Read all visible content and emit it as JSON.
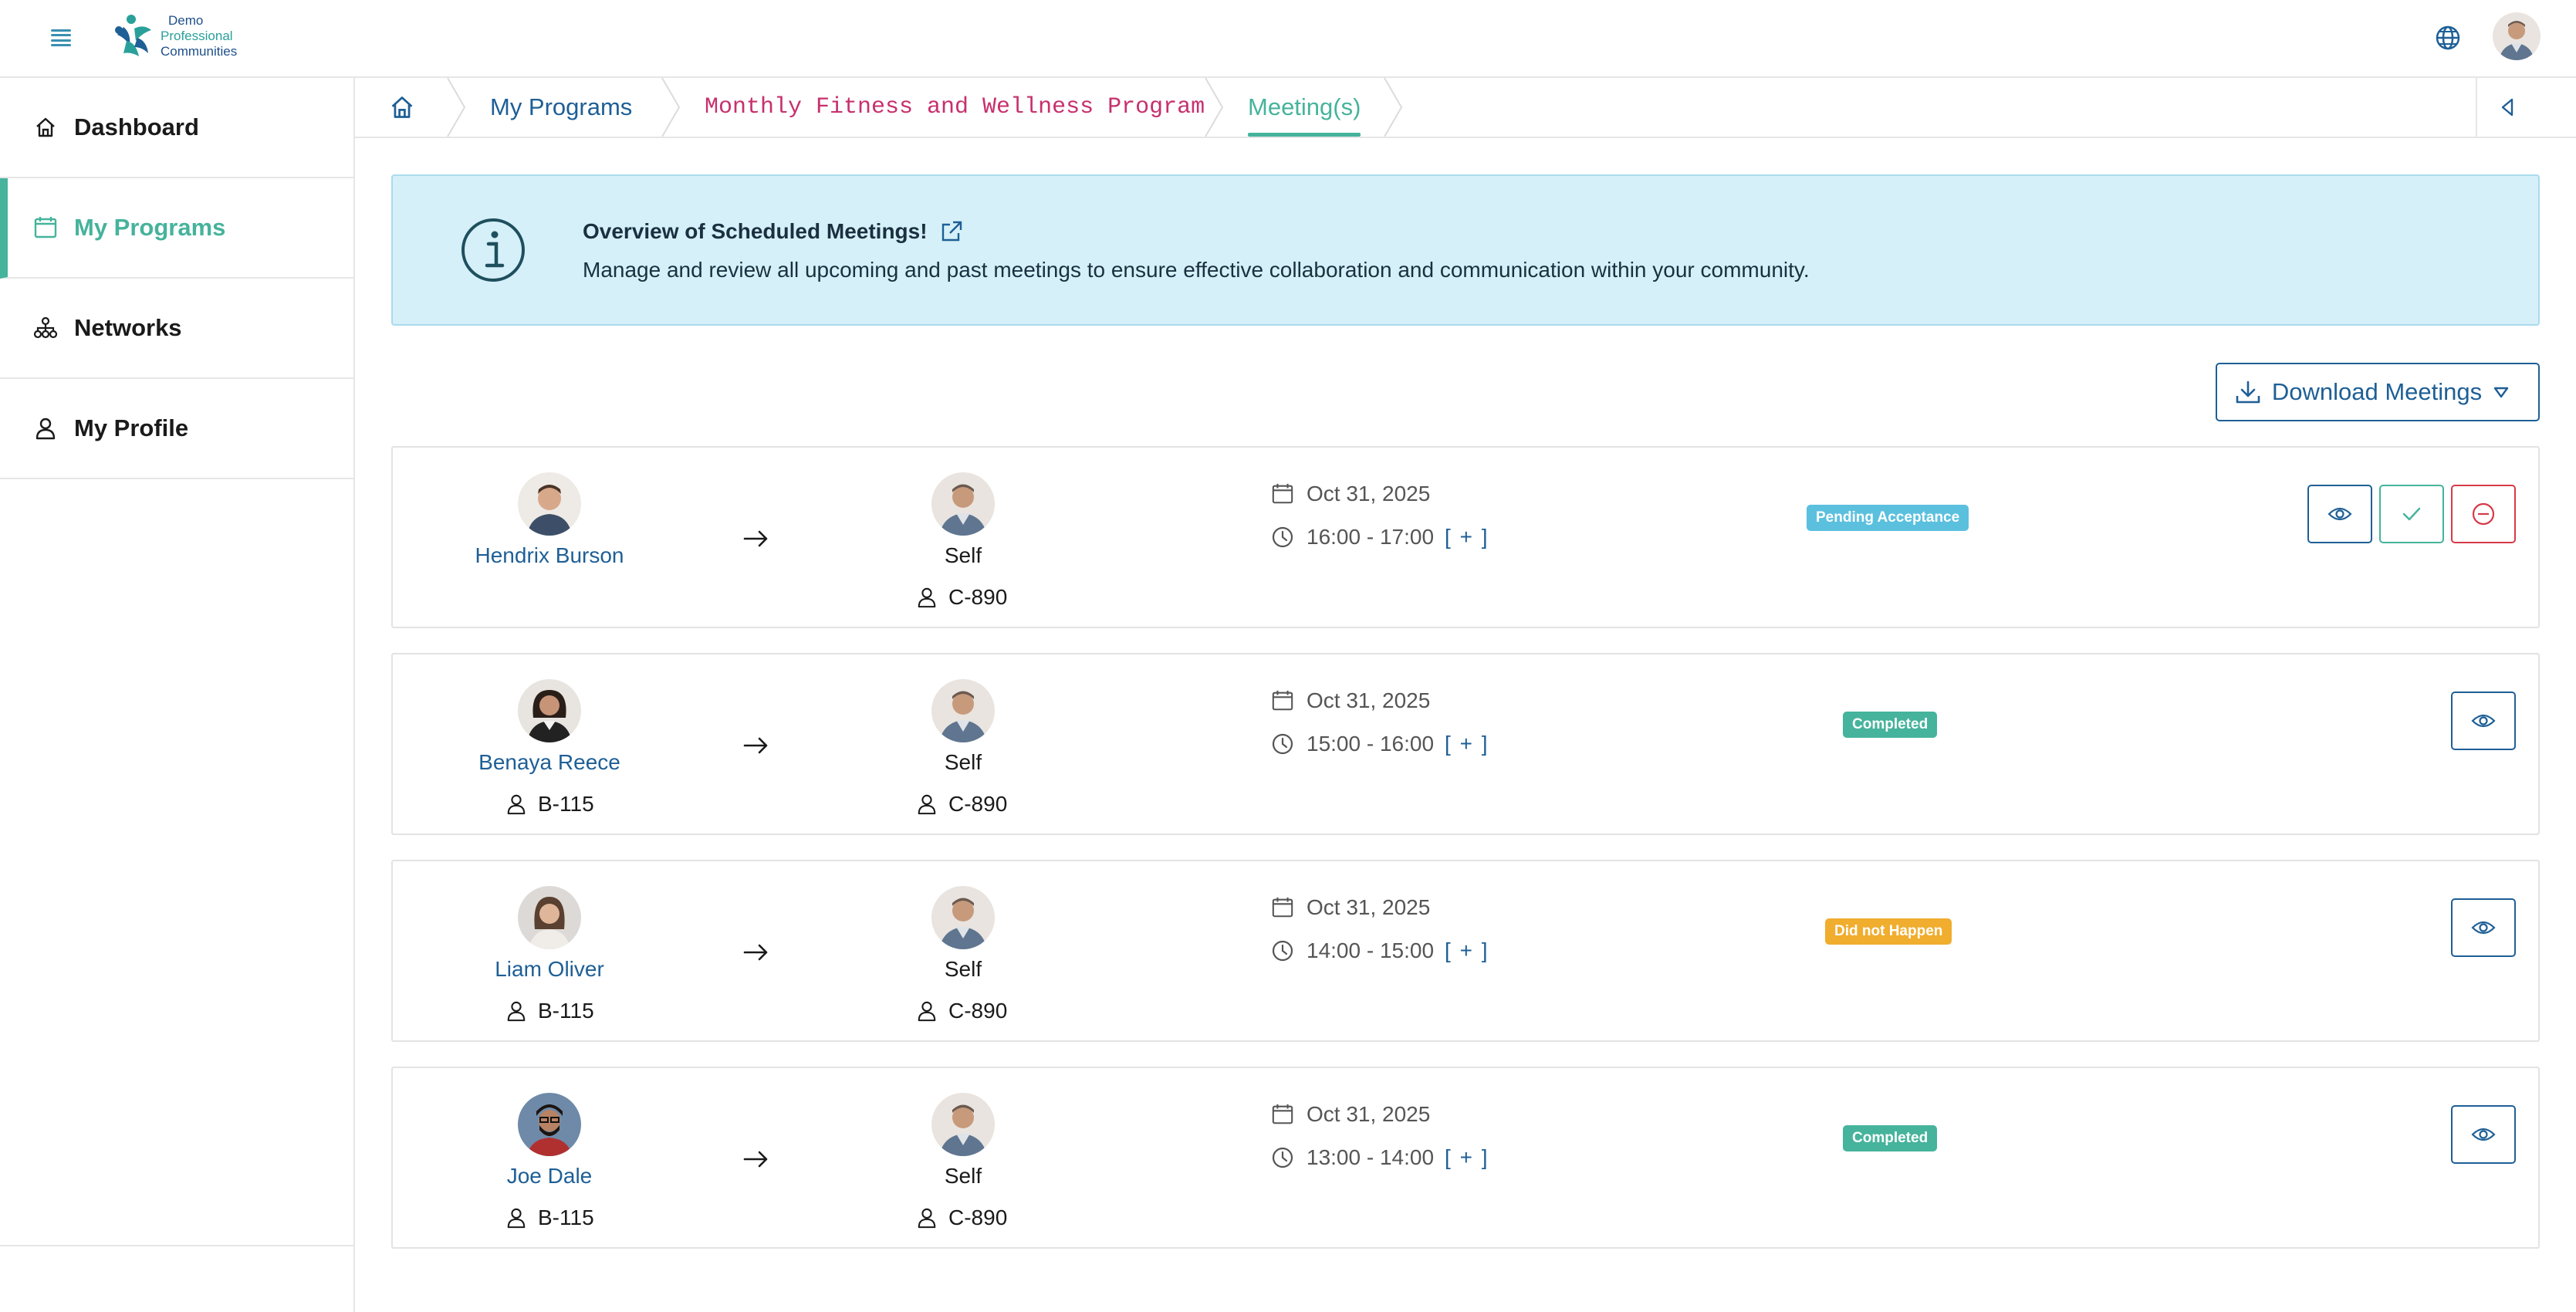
{
  "logo": {
    "line1": "Demo",
    "line2": "Professional",
    "line3": "Communities"
  },
  "sidebar": {
    "items": [
      {
        "label": "Dashboard",
        "icon": "home-icon",
        "active": false
      },
      {
        "label": "My Programs",
        "icon": "calendar-icon",
        "active": true
      },
      {
        "label": "Networks",
        "icon": "network-icon",
        "active": false
      },
      {
        "label": "My Profile",
        "icon": "user-icon",
        "active": false
      }
    ]
  },
  "breadcrumb": {
    "home_icon": "home-icon",
    "items": [
      "My Programs",
      "Monthly Fitness and Wellness Program",
      "Meeting(s)"
    ]
  },
  "info": {
    "title": "Overview of Scheduled Meetings!",
    "description": "Manage and review all upcoming and past meetings to ensure effective collaboration and communication within your community."
  },
  "download": {
    "label": "Download Meetings"
  },
  "colors": {
    "accent": "#46b39c",
    "link": "#1e5f96",
    "pending": "#5bc0de",
    "completed": "#46b39c",
    "did_not_happen": "#f0ad2e",
    "reject": "#d63a48",
    "info_bg": "#d5f0f8"
  },
  "meetings": [
    {
      "from_name": "Hendrix Burson",
      "from_code": "",
      "to_name": "Self",
      "to_code": "C-890",
      "date": "Oct 31, 2025",
      "time": "16:00 - 17:00",
      "plus": "[ + ]",
      "status": "Pending Acceptance",
      "status_color": "#5bc0de"
    },
    {
      "from_name": "Benaya Reece",
      "from_code": "B-115",
      "to_name": "Self",
      "to_code": "C-890",
      "date": "Oct 31, 2025",
      "time": "15:00 - 16:00",
      "plus": "[ + ]",
      "status": "Completed",
      "status_color": "#46b39c"
    },
    {
      "from_name": "Liam Oliver",
      "from_code": "B-115",
      "to_name": "Self",
      "to_code": "C-890",
      "date": "Oct 31, 2025",
      "time": "14:00 - 15:00",
      "plus": "[ + ]",
      "status": "Did not Happen",
      "status_color": "#f0ad2e"
    },
    {
      "from_name": "Joe Dale",
      "from_code": "B-115",
      "to_name": "Self",
      "to_code": "C-890",
      "date": "Oct 31, 2025",
      "time": "13:00 - 14:00",
      "plus": "[ + ]",
      "status": "Completed",
      "status_color": "#46b39c"
    }
  ]
}
